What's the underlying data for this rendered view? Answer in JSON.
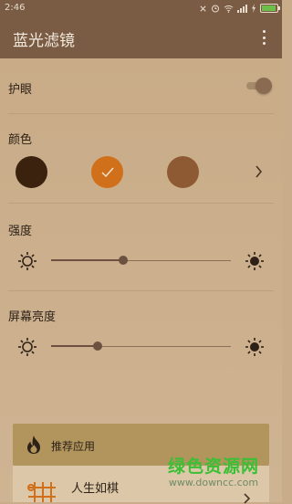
{
  "status_bar": {
    "time": "2:46"
  },
  "app_bar": {
    "title": "蓝光滤镜"
  },
  "eye_protection": {
    "label": "护眼",
    "enabled": true
  },
  "color": {
    "label": "颜色",
    "swatches": [
      {
        "color": "#3a220f",
        "selected": false
      },
      {
        "color": "#d1701a",
        "selected": true
      },
      {
        "color": "#8e5a34",
        "selected": false
      }
    ]
  },
  "intensity": {
    "label": "强度",
    "value_percent": 40
  },
  "screen_brightness": {
    "label": "屏幕亮度",
    "value_percent": 26
  },
  "recommend": {
    "title": "推荐应用",
    "app_name": "人生如棋"
  },
  "watermark": {
    "text": "绿色资源网",
    "url": "www.downcc.com"
  },
  "colors": {
    "toolbar": "#7a5c45",
    "background": "#c9ab87",
    "accent": "#d1701a"
  }
}
